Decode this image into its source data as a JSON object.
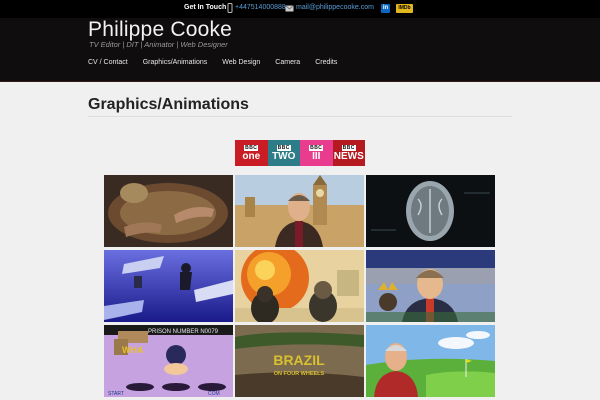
{
  "topbar": {
    "get_in_touch": "Get In Touch",
    "phone": "+447514000888",
    "email": "mail@philippecooke.com",
    "linkedin_icon": "linkedin-icon",
    "imdb_label": "IMDb"
  },
  "header": {
    "title": "Philippe Cooke",
    "tagline": "TV Editor | DIT | Animator | Web Designer",
    "nav": [
      "CV / Contact",
      "Graphics/Animations",
      "Web Design",
      "Camera",
      "Credits"
    ]
  },
  "page": {
    "title": "Graphics/Animations"
  },
  "bbc_channels": [
    {
      "top": "BBC",
      "name": "one"
    },
    {
      "top": "BBC",
      "name": "TWO"
    },
    {
      "top": "BBC",
      "name": "III"
    },
    {
      "top": "BBC",
      "name": "NEWS"
    }
  ],
  "thumbnails": [
    {
      "name": "thumb-hands",
      "text": ""
    },
    {
      "name": "thumb-westminster-presenter",
      "text": ""
    },
    {
      "name": "thumb-brain-scan",
      "text": ""
    },
    {
      "name": "thumb-falling-figure",
      "text": ""
    },
    {
      "name": "thumb-explosion-interview",
      "text": ""
    },
    {
      "name": "thumb-crowned-presenter",
      "text": ""
    },
    {
      "name": "thumb-whack-game",
      "text": "PRISON NUMBER N0079",
      "sub": "START",
      "corner": "COM"
    },
    {
      "name": "thumb-brazil-wheels",
      "text": "BRAZIL",
      "sub": "ON FOUR WHEELS"
    },
    {
      "name": "thumb-golfer",
      "text": ""
    }
  ],
  "colors": {
    "link": "#5a9cd6",
    "header_bg": "#100d0f",
    "page_bg": "#f0f0f0"
  }
}
